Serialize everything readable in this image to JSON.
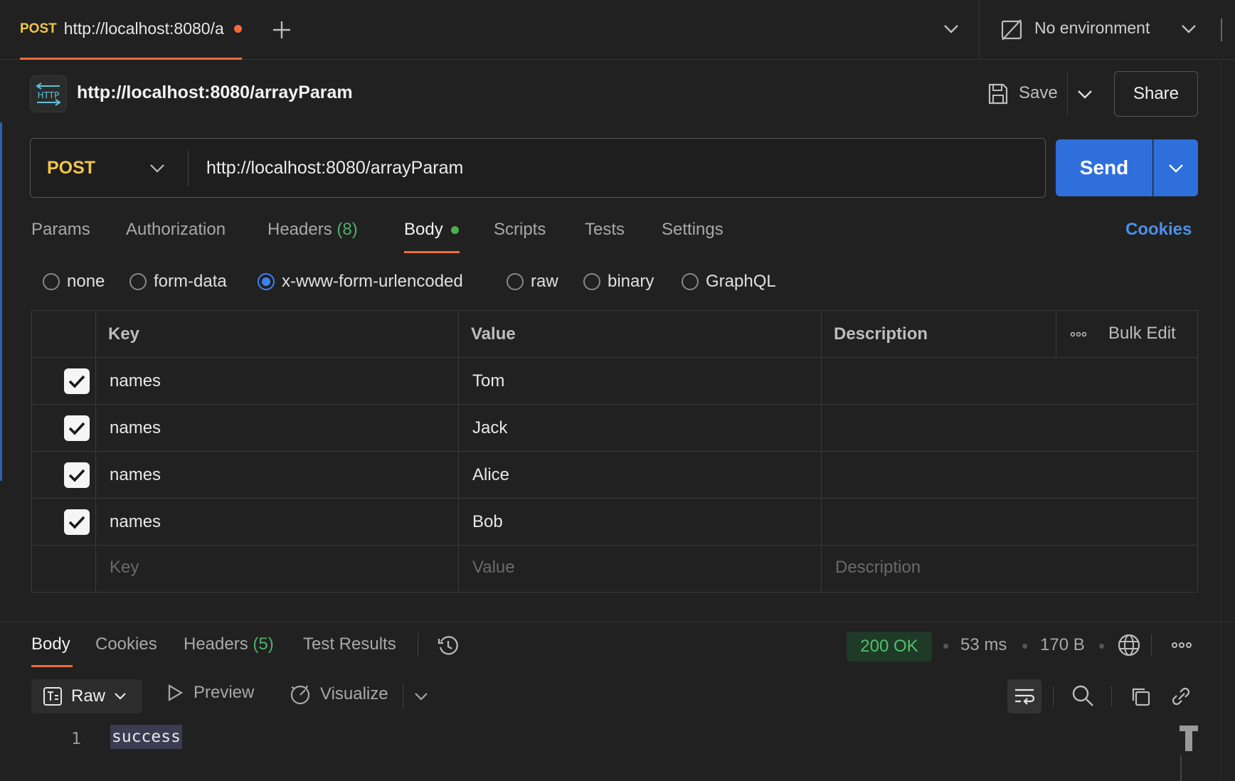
{
  "tabbar": {
    "method": "POST",
    "url": "http://localhost:8080/a",
    "environment": "No environment"
  },
  "request": {
    "name": "http://localhost:8080/arrayParam",
    "method": "POST",
    "url": "http://localhost:8080/arrayParam",
    "save_label": "Save",
    "share_label": "Share",
    "send_label": "Send",
    "http_badge": "HTTP"
  },
  "request_tabs": {
    "params": "Params",
    "authorization": "Authorization",
    "headers": "Headers",
    "headers_count": "(8)",
    "body": "Body",
    "scripts": "Scripts",
    "tests": "Tests",
    "settings": "Settings",
    "cookies": "Cookies"
  },
  "body_types": {
    "none": "none",
    "form_data": "form-data",
    "urlencoded": "x-www-form-urlencoded",
    "raw": "raw",
    "binary": "binary",
    "graphql": "GraphQL"
  },
  "table": {
    "headers": {
      "key": "Key",
      "value": "Value",
      "description": "Description",
      "bulk_edit": "Bulk Edit"
    },
    "rows": [
      {
        "key": "names",
        "value": "Tom",
        "checked": true
      },
      {
        "key": "names",
        "value": "Jack",
        "checked": true
      },
      {
        "key": "names",
        "value": "Alice",
        "checked": true
      },
      {
        "key": "names",
        "value": "Bob",
        "checked": true
      }
    ],
    "placeholders": {
      "key": "Key",
      "value": "Value",
      "description": "Description"
    }
  },
  "response": {
    "tabs": {
      "body": "Body",
      "cookies": "Cookies",
      "headers": "Headers",
      "headers_count": "(5)",
      "test_results": "Test Results"
    },
    "status": "200 OK",
    "time": "53 ms",
    "size": "170 B",
    "format": "Raw",
    "preview": "Preview",
    "visualize": "Visualize",
    "line_number": "1",
    "body_text": "success"
  },
  "colors": {
    "accent_orange": "#f26b3a",
    "method_yellow": "#f0c64a",
    "send_blue": "#2f6fdb",
    "success_green": "#4fc06d"
  }
}
